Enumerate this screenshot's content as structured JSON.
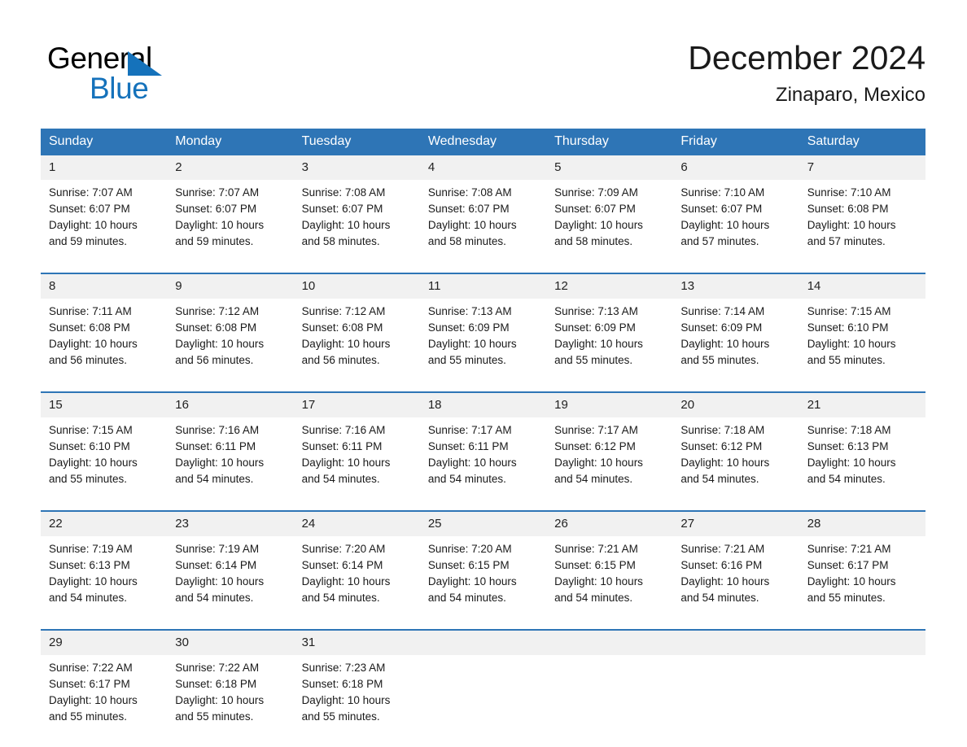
{
  "brand": {
    "name_top": "General",
    "name_bottom": "Blue",
    "triangle_color": "#1572bb",
    "text_color": "#000000"
  },
  "header": {
    "title": "December 2024",
    "subtitle": "Zinaparo, Mexico"
  },
  "theme": {
    "header_bg": "#2e75b6",
    "header_text": "#ffffff",
    "daynum_bg": "#f1f1f1",
    "row_border": "#2e75b6",
    "body_text": "#1a1a1a"
  },
  "weekday_headers": [
    "Sunday",
    "Monday",
    "Tuesday",
    "Wednesday",
    "Thursday",
    "Friday",
    "Saturday"
  ],
  "weeks": [
    [
      {
        "day": "1",
        "sunrise": "Sunrise: 7:07 AM",
        "sunset": "Sunset: 6:07 PM",
        "daylight_1": "Daylight: 10 hours",
        "daylight_2": "and 59 minutes."
      },
      {
        "day": "2",
        "sunrise": "Sunrise: 7:07 AM",
        "sunset": "Sunset: 6:07 PM",
        "daylight_1": "Daylight: 10 hours",
        "daylight_2": "and 59 minutes."
      },
      {
        "day": "3",
        "sunrise": "Sunrise: 7:08 AM",
        "sunset": "Sunset: 6:07 PM",
        "daylight_1": "Daylight: 10 hours",
        "daylight_2": "and 58 minutes."
      },
      {
        "day": "4",
        "sunrise": "Sunrise: 7:08 AM",
        "sunset": "Sunset: 6:07 PM",
        "daylight_1": "Daylight: 10 hours",
        "daylight_2": "and 58 minutes."
      },
      {
        "day": "5",
        "sunrise": "Sunrise: 7:09 AM",
        "sunset": "Sunset: 6:07 PM",
        "daylight_1": "Daylight: 10 hours",
        "daylight_2": "and 58 minutes."
      },
      {
        "day": "6",
        "sunrise": "Sunrise: 7:10 AM",
        "sunset": "Sunset: 6:07 PM",
        "daylight_1": "Daylight: 10 hours",
        "daylight_2": "and 57 minutes."
      },
      {
        "day": "7",
        "sunrise": "Sunrise: 7:10 AM",
        "sunset": "Sunset: 6:08 PM",
        "daylight_1": "Daylight: 10 hours",
        "daylight_2": "and 57 minutes."
      }
    ],
    [
      {
        "day": "8",
        "sunrise": "Sunrise: 7:11 AM",
        "sunset": "Sunset: 6:08 PM",
        "daylight_1": "Daylight: 10 hours",
        "daylight_2": "and 56 minutes."
      },
      {
        "day": "9",
        "sunrise": "Sunrise: 7:12 AM",
        "sunset": "Sunset: 6:08 PM",
        "daylight_1": "Daylight: 10 hours",
        "daylight_2": "and 56 minutes."
      },
      {
        "day": "10",
        "sunrise": "Sunrise: 7:12 AM",
        "sunset": "Sunset: 6:08 PM",
        "daylight_1": "Daylight: 10 hours",
        "daylight_2": "and 56 minutes."
      },
      {
        "day": "11",
        "sunrise": "Sunrise: 7:13 AM",
        "sunset": "Sunset: 6:09 PM",
        "daylight_1": "Daylight: 10 hours",
        "daylight_2": "and 55 minutes."
      },
      {
        "day": "12",
        "sunrise": "Sunrise: 7:13 AM",
        "sunset": "Sunset: 6:09 PM",
        "daylight_1": "Daylight: 10 hours",
        "daylight_2": "and 55 minutes."
      },
      {
        "day": "13",
        "sunrise": "Sunrise: 7:14 AM",
        "sunset": "Sunset: 6:09 PM",
        "daylight_1": "Daylight: 10 hours",
        "daylight_2": "and 55 minutes."
      },
      {
        "day": "14",
        "sunrise": "Sunrise: 7:15 AM",
        "sunset": "Sunset: 6:10 PM",
        "daylight_1": "Daylight: 10 hours",
        "daylight_2": "and 55 minutes."
      }
    ],
    [
      {
        "day": "15",
        "sunrise": "Sunrise: 7:15 AM",
        "sunset": "Sunset: 6:10 PM",
        "daylight_1": "Daylight: 10 hours",
        "daylight_2": "and 55 minutes."
      },
      {
        "day": "16",
        "sunrise": "Sunrise: 7:16 AM",
        "sunset": "Sunset: 6:11 PM",
        "daylight_1": "Daylight: 10 hours",
        "daylight_2": "and 54 minutes."
      },
      {
        "day": "17",
        "sunrise": "Sunrise: 7:16 AM",
        "sunset": "Sunset: 6:11 PM",
        "daylight_1": "Daylight: 10 hours",
        "daylight_2": "and 54 minutes."
      },
      {
        "day": "18",
        "sunrise": "Sunrise: 7:17 AM",
        "sunset": "Sunset: 6:11 PM",
        "daylight_1": "Daylight: 10 hours",
        "daylight_2": "and 54 minutes."
      },
      {
        "day": "19",
        "sunrise": "Sunrise: 7:17 AM",
        "sunset": "Sunset: 6:12 PM",
        "daylight_1": "Daylight: 10 hours",
        "daylight_2": "and 54 minutes."
      },
      {
        "day": "20",
        "sunrise": "Sunrise: 7:18 AM",
        "sunset": "Sunset: 6:12 PM",
        "daylight_1": "Daylight: 10 hours",
        "daylight_2": "and 54 minutes."
      },
      {
        "day": "21",
        "sunrise": "Sunrise: 7:18 AM",
        "sunset": "Sunset: 6:13 PM",
        "daylight_1": "Daylight: 10 hours",
        "daylight_2": "and 54 minutes."
      }
    ],
    [
      {
        "day": "22",
        "sunrise": "Sunrise: 7:19 AM",
        "sunset": "Sunset: 6:13 PM",
        "daylight_1": "Daylight: 10 hours",
        "daylight_2": "and 54 minutes."
      },
      {
        "day": "23",
        "sunrise": "Sunrise: 7:19 AM",
        "sunset": "Sunset: 6:14 PM",
        "daylight_1": "Daylight: 10 hours",
        "daylight_2": "and 54 minutes."
      },
      {
        "day": "24",
        "sunrise": "Sunrise: 7:20 AM",
        "sunset": "Sunset: 6:14 PM",
        "daylight_1": "Daylight: 10 hours",
        "daylight_2": "and 54 minutes."
      },
      {
        "day": "25",
        "sunrise": "Sunrise: 7:20 AM",
        "sunset": "Sunset: 6:15 PM",
        "daylight_1": "Daylight: 10 hours",
        "daylight_2": "and 54 minutes."
      },
      {
        "day": "26",
        "sunrise": "Sunrise: 7:21 AM",
        "sunset": "Sunset: 6:15 PM",
        "daylight_1": "Daylight: 10 hours",
        "daylight_2": "and 54 minutes."
      },
      {
        "day": "27",
        "sunrise": "Sunrise: 7:21 AM",
        "sunset": "Sunset: 6:16 PM",
        "daylight_1": "Daylight: 10 hours",
        "daylight_2": "and 54 minutes."
      },
      {
        "day": "28",
        "sunrise": "Sunrise: 7:21 AM",
        "sunset": "Sunset: 6:17 PM",
        "daylight_1": "Daylight: 10 hours",
        "daylight_2": "and 55 minutes."
      }
    ],
    [
      {
        "day": "29",
        "sunrise": "Sunrise: 7:22 AM",
        "sunset": "Sunset: 6:17 PM",
        "daylight_1": "Daylight: 10 hours",
        "daylight_2": "and 55 minutes."
      },
      {
        "day": "30",
        "sunrise": "Sunrise: 7:22 AM",
        "sunset": "Sunset: 6:18 PM",
        "daylight_1": "Daylight: 10 hours",
        "daylight_2": "and 55 minutes."
      },
      {
        "day": "31",
        "sunrise": "Sunrise: 7:23 AM",
        "sunset": "Sunset: 6:18 PM",
        "daylight_1": "Daylight: 10 hours",
        "daylight_2": "and 55 minutes."
      },
      {
        "day": "",
        "sunrise": "",
        "sunset": "",
        "daylight_1": "",
        "daylight_2": ""
      },
      {
        "day": "",
        "sunrise": "",
        "sunset": "",
        "daylight_1": "",
        "daylight_2": ""
      },
      {
        "day": "",
        "sunrise": "",
        "sunset": "",
        "daylight_1": "",
        "daylight_2": ""
      },
      {
        "day": "",
        "sunrise": "",
        "sunset": "",
        "daylight_1": "",
        "daylight_2": ""
      }
    ]
  ]
}
